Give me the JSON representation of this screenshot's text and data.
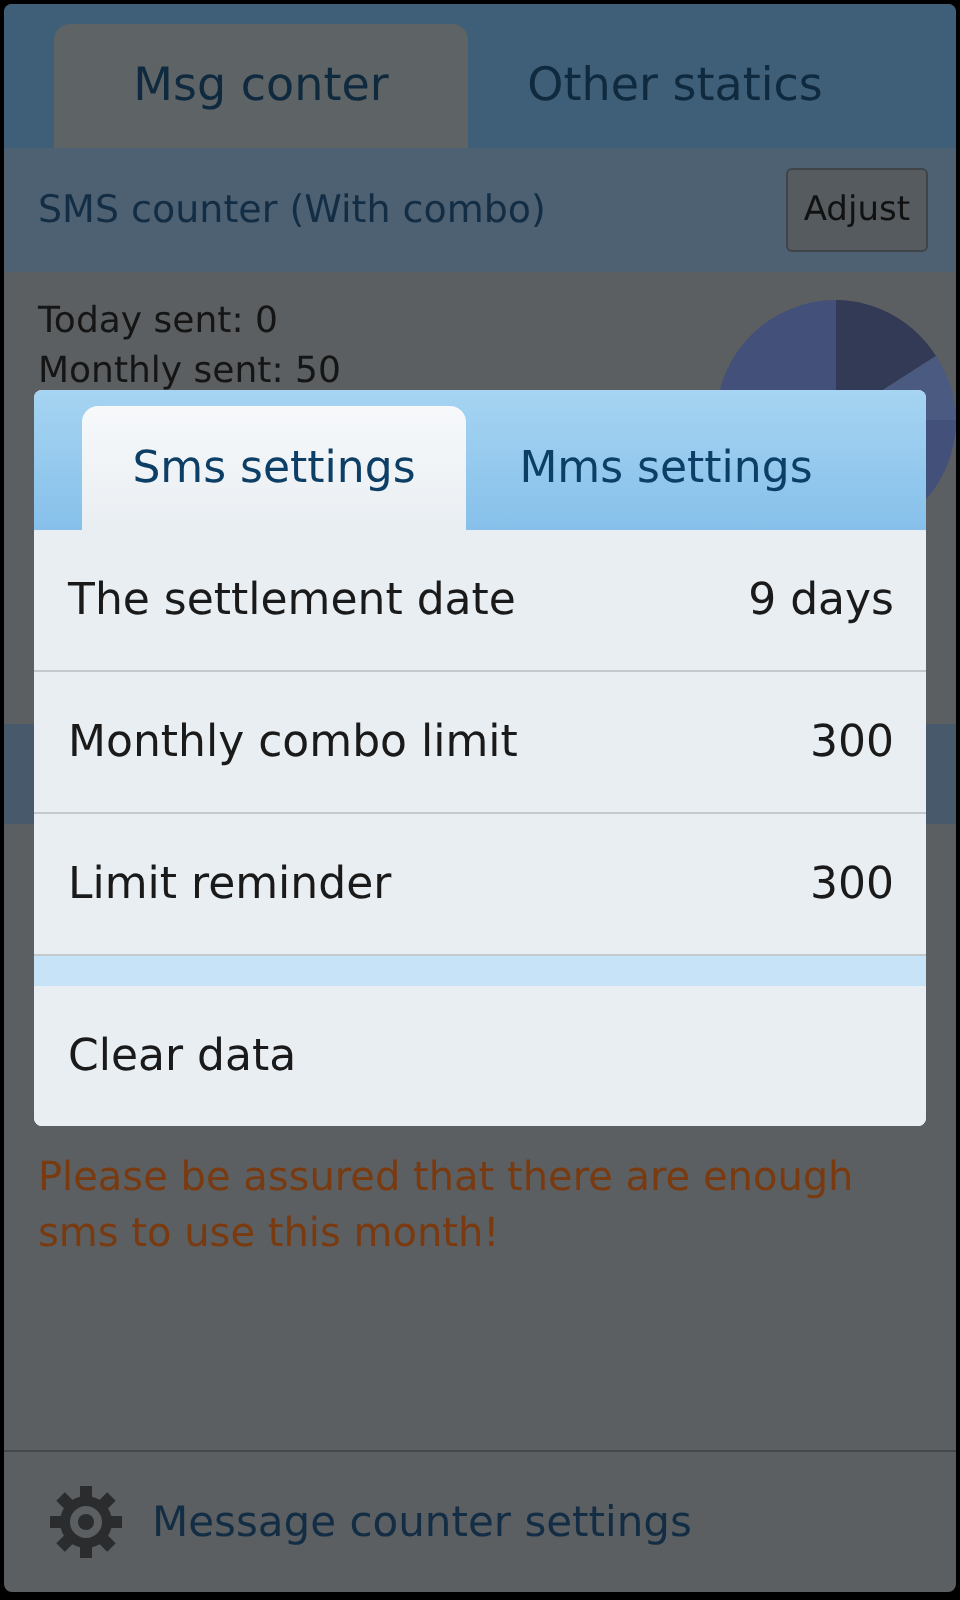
{
  "main_tabs": [
    {
      "label": "Msg conter",
      "selected": true
    },
    {
      "label": "Other statics",
      "selected": false
    }
  ],
  "sms_counter": {
    "title": "SMS counter (With combo)",
    "adjust_button": "Adjust",
    "today_sent": "Today sent: 0",
    "monthly_sent": "Monthly sent: 50"
  },
  "notice": "Please be assured that there are enough sms to use this month!",
  "footer": {
    "label": "Message counter settings"
  },
  "dialog": {
    "tabs": [
      {
        "label": "Sms settings",
        "selected": true
      },
      {
        "label": "Mms settings",
        "selected": false
      }
    ],
    "rows": [
      {
        "label": "The settlement date",
        "value": "9 days"
      },
      {
        "label": "Monthly combo limit",
        "value": "300"
      },
      {
        "label": "Limit reminder",
        "value": "300"
      }
    ],
    "actions": [
      {
        "label": "Clear data"
      }
    ]
  }
}
